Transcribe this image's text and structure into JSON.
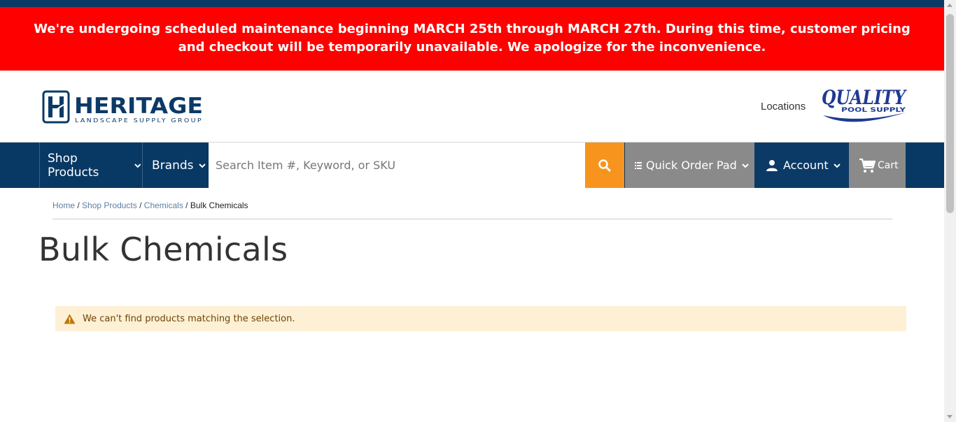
{
  "banner": {
    "message": "We're undergoing scheduled maintenance beginning MARCH 25th through MARCH 27th. During this time, customer pricing and checkout will be temporarily unavailable. We apologize for the inconvenience."
  },
  "header": {
    "logo_main": "HERITAGE",
    "logo_tagline": "LANDSCAPE SUPPLY GROUP",
    "locations_label": "Locations",
    "partner_logo_line1": "QUALITY",
    "partner_logo_line2": "POOL SUPPLY"
  },
  "nav": {
    "shop_products": "Shop Products",
    "brands": "Brands",
    "search_placeholder": "Search Item #, Keyword, or SKU",
    "quick_order_pad": "Quick Order Pad",
    "account": "Account",
    "cart": "Cart"
  },
  "breadcrumb": {
    "home": "Home",
    "shop_products": "Shop Products",
    "chemicals": "Chemicals",
    "current": "Bulk Chemicals",
    "separator": "/"
  },
  "page": {
    "title": "Bulk Chemicals",
    "notice": "We can't find products matching the selection."
  },
  "colors": {
    "banner_bg": "#fe0000",
    "nav_bg": "#083864",
    "search_button": "#f7941d",
    "gray_button": "#8a8a8a",
    "notice_bg": "#fdf0d5"
  },
  "icons": {
    "search": "search-icon",
    "chevron": "chevron-down-icon",
    "quick_order": "list-icon",
    "account": "user-icon",
    "cart": "cart-icon",
    "warning": "warning-icon"
  }
}
